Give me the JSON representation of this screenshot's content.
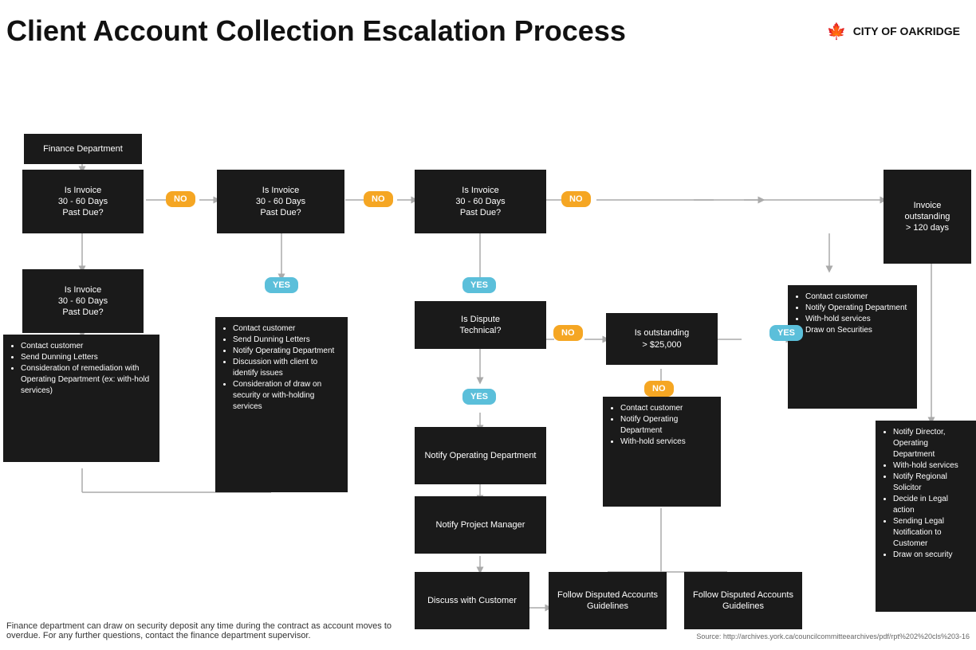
{
  "header": {
    "title": "Client Account Collection Escalation Process",
    "logo_text": "CITY OF OAKRIDGE",
    "logo_icon": "🍁"
  },
  "footer": {
    "note": "Finance department can draw on security deposit any time during the contract as account moves to overdue. For any further questions, contact the finance department supervisor.",
    "source": "Source: http://archives.york.ca/councilcommitteearchives/pdf/rpt%202%20cls%203-16"
  },
  "boxes": {
    "finance_dept": "Finance Department",
    "invoice_30_60_1": "Is Invoice\n30 - 60 Days\nPast Due?",
    "invoice_30_60_2": "Is Invoice\n30 - 60 Days\nPast Due?",
    "invoice_30_60_3": "Is Invoice\n30 - 60 Days\nPast Due?",
    "invoice_30_60_4": "Is Invoice\n30 - 60 Days\nPast Due?",
    "invoice_outstanding": "Invoice outstanding\n> 120 days",
    "is_dispute_technical": "Is Dispute\nTechnical?",
    "is_outstanding_25k": "Is outstanding\n> $25,000",
    "notify_operating_dept": "Notify Operating\nDepartment",
    "notify_project_manager": "Notify Project\nManager",
    "discuss_with_customer": "Discuss with\nCustomer",
    "follow_disputed_1": "Follow Disputed\nAccounts Guidelines",
    "follow_disputed_2": "Follow Disputed\nAccounts Guidelines",
    "list1_items": [
      "Contact customer",
      "Send Dunning Letters",
      "Consideration of remediation with Operating Department (ex: with-hold services)"
    ],
    "list2_items": [
      "Contact customer",
      "Send Dunning Letters",
      "Notify Operating Department",
      "Discussion with client to identify issues",
      "Consideration of draw on security or with-holding services"
    ],
    "list3_items": [
      "Contact customer",
      "Notify Operating Department",
      "With-hold services"
    ],
    "list4_items": [
      "Contact customer",
      "Notify Operating Department",
      "With-hold services",
      "Draw on Securities"
    ],
    "list5_items": [
      "Notify Director, Operating Department",
      "With-hold services",
      "Notify Regional Solicitor",
      "Decide in Legal action",
      "Sending Legal Notification to Customer",
      "Draw on security"
    ]
  },
  "badges": {
    "no": "NO",
    "yes": "YES"
  }
}
